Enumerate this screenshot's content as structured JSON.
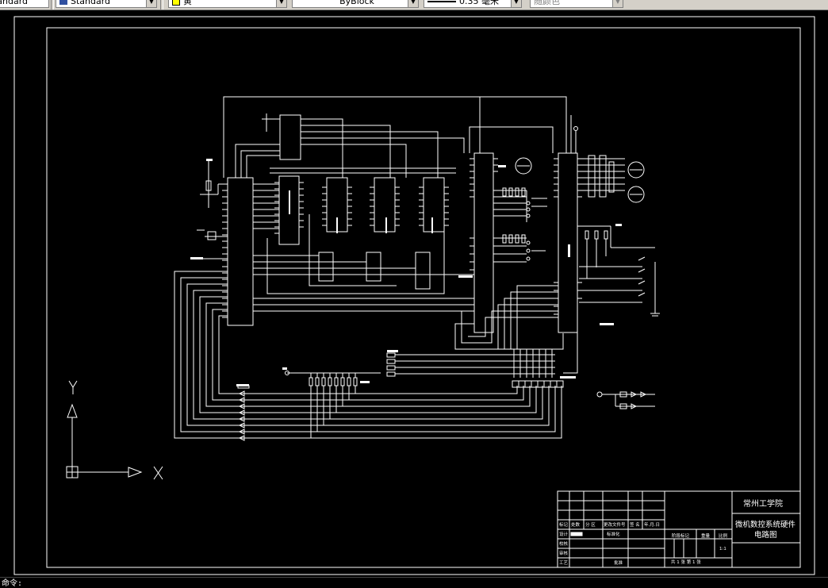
{
  "toolbar": {
    "text_style": "Standard",
    "layer": "黄",
    "linetype": "ByBlock",
    "lineweight": "0.35 毫米",
    "plot_style": "随颜色"
  },
  "drawing": {
    "ucs": {
      "x_label": "X",
      "y_label": "Y"
    },
    "title_block": {
      "school": "常州工学院",
      "drawing_title_line1": "微机数控系统硬件",
      "drawing_title_line2": "电路图",
      "col_headers": [
        "标记",
        "处数",
        "分 区",
        "更改文件号",
        "签 名",
        "年.月.日"
      ],
      "row_design": "设计",
      "row_standard": "标准化",
      "row_check": "校核",
      "row_audit": "审核",
      "row_process": "工艺",
      "row_approve": "批准",
      "stage_mark": "阶段标记",
      "weight": "重量",
      "scale": "比例",
      "scale_value": "1:1",
      "sheet_info": "共 1 张   第 1 张"
    }
  },
  "colors": {
    "background": "#000000",
    "lines": "#ffffff",
    "toolbar": "#d4d0c8"
  },
  "command_prompt": "命令:"
}
